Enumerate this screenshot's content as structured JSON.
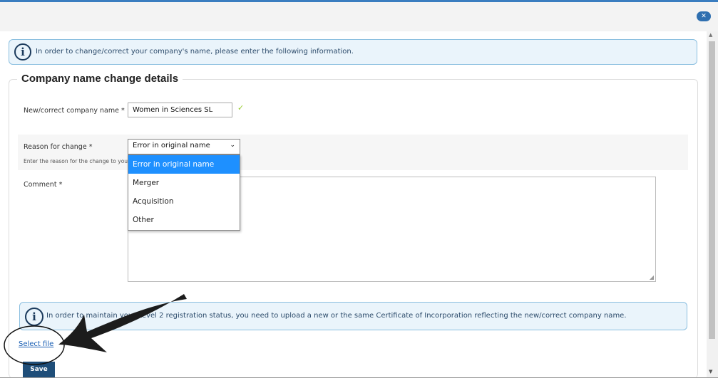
{
  "window": {
    "close_label": "✕"
  },
  "banner_top": {
    "text": "In order to change/correct your company's name, please enter the following information."
  },
  "section": {
    "title": "Company name change details"
  },
  "form": {
    "company_name": {
      "label": "New/correct company name *",
      "value": "Women in Sciences SL"
    },
    "reason": {
      "label": "Reason for change *",
      "hint": "Enter the reason for the change to your",
      "selected": "Error in original name",
      "options": [
        "Error in original name",
        "Merger",
        "Acquisition",
        "Other"
      ]
    },
    "comment": {
      "label": "Comment *"
    }
  },
  "banner_bottom": {
    "text": "In order to maintain your Level 2 registration status, you need to upload a new or the same Certificate of Incorporation reflecting the new/correct company name."
  },
  "actions": {
    "select_file": "Select file",
    "save": "Save"
  },
  "colors": {
    "accent": "#1f4e79",
    "highlight": "#1e90ff",
    "info_bg": "#eaf4fb",
    "info_border": "#8bbfe0",
    "check": "#9acd32"
  }
}
